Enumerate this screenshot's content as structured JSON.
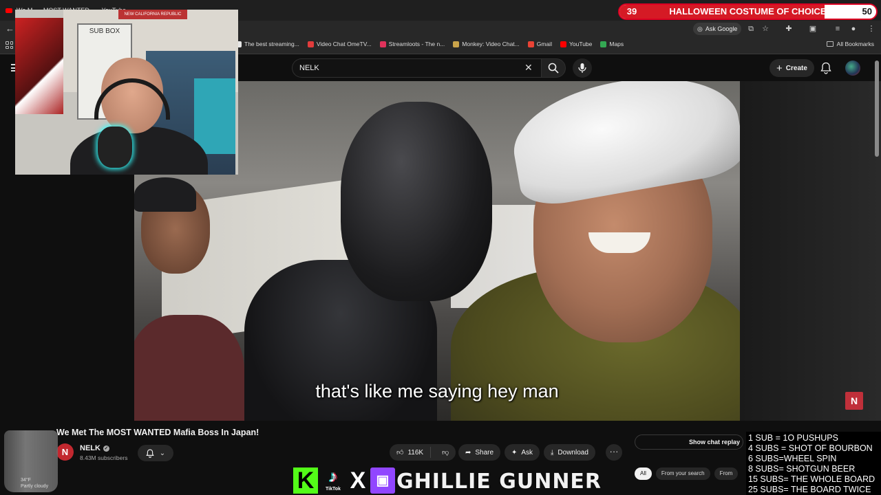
{
  "browser": {
    "tab_title": "We M... - MOST WANTED ... - YouTube",
    "ask_google": "Ask Google",
    "bookmarks": [
      {
        "label": "The best streaming...",
        "color": "#e6e6e6"
      },
      {
        "label": "Video Chat OmeTV...",
        "color": "#e23c3c"
      },
      {
        "label": "Streamloots - The n...",
        "color": "#e0325b"
      },
      {
        "label": "Monkey: Video Chat...",
        "color": "#c9a34a"
      },
      {
        "label": "Gmail",
        "color": "#ea4335"
      },
      {
        "label": "YouTube",
        "color": "#ff0000"
      },
      {
        "label": "Maps",
        "color": "#34a853"
      }
    ],
    "all_bookmarks": "All Bookmarks"
  },
  "youtube": {
    "search_value": "NELK",
    "create_label": "Create",
    "caption": "that's like me saying hey man",
    "video_title": "We Met The MOST WANTED Mafia Boss In Japan!",
    "channel_initial": "N",
    "channel_name": "NELK",
    "subscribers": "8.43M subscribers",
    "likes": "116K",
    "share_label": "Share",
    "ask_label": "Ask",
    "download_label": "Download",
    "more_label": "···",
    "show_chat_replay": "Show chat replay",
    "chips": [
      "All",
      "From your search",
      "From"
    ],
    "watermark": "N"
  },
  "overlay": {
    "goal_current": "39",
    "goal_title": "HALLOWEEN COSTUME OF CHOICE",
    "goal_target": "50",
    "goal_progress": 0.78,
    "webcam_board": "SUB BOX",
    "webcam_banner": "NEW CALIFORNIA REPUBLIC",
    "weather_temp": "34°F",
    "weather_desc": "Partly cloudy",
    "tiktok_label": "TikTok",
    "handle": "GHILLIE GUNNER",
    "sub_goals": [
      "1 SUB = 1O PUSHUPS",
      "4 SUBS = SHOT OF BOURBON",
      "6 SUBS=WHEEL SPIN",
      "8 SUBS= SHOTGUN BEER",
      "15 SUBS= THE WHOLE BOARD",
      "25 SUBS= THE  BOARD TWICE"
    ]
  }
}
